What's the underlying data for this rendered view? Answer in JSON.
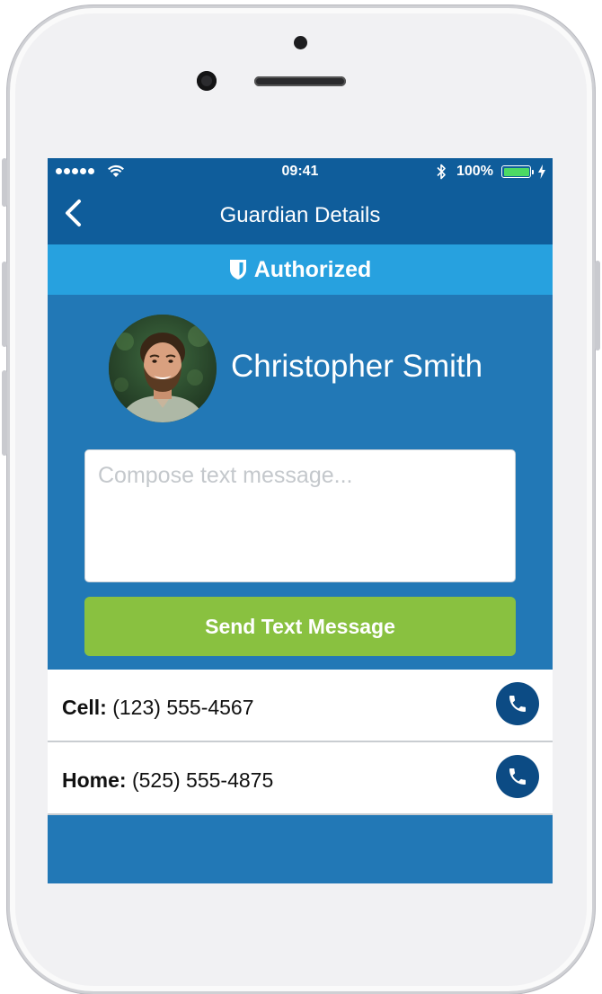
{
  "colors": {
    "navbar": "#0f5d9b",
    "banner": "#27a1df",
    "background": "#2278b6",
    "send_button": "#89c140",
    "call_button": "#0c4b84"
  },
  "status_bar": {
    "time": "09:41",
    "battery": "100%"
  },
  "nav": {
    "back_icon": "chevron-left-icon",
    "title": "Guardian Details"
  },
  "banner": {
    "icon": "shield-icon",
    "label": "Authorized"
  },
  "guardian": {
    "name": "Christopher Smith"
  },
  "compose": {
    "placeholder": "Compose text message..."
  },
  "send_button": {
    "label": "Send Text Message"
  },
  "contacts": [
    {
      "label": "Cell:",
      "number": "(123) 555-4567",
      "icon": "phone-icon"
    },
    {
      "label": "Home:",
      "number": "(525) 555-4875",
      "icon": "phone-icon"
    }
  ]
}
